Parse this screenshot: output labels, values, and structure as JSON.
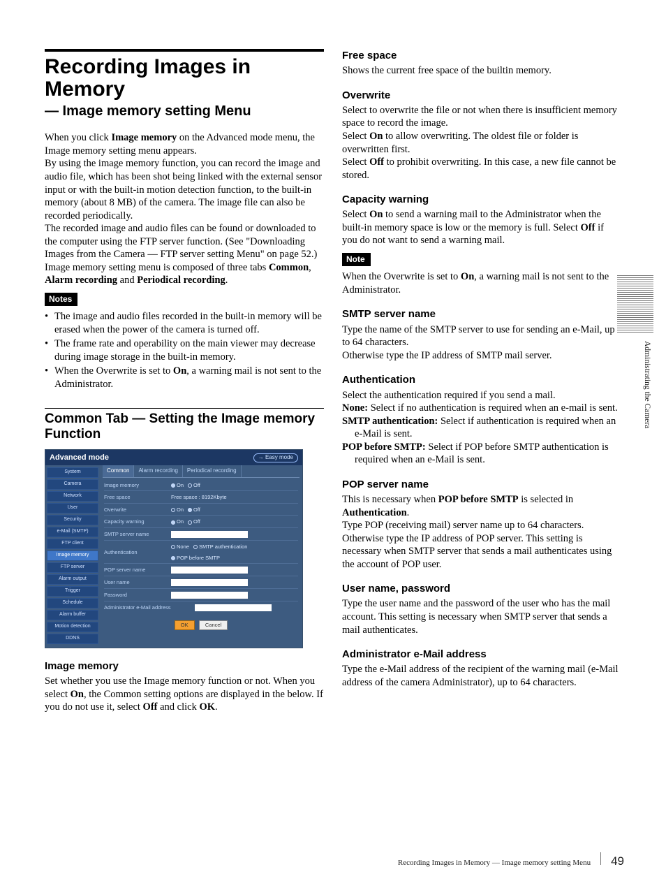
{
  "title": "Recording Images in Memory",
  "subtitle": "— Image memory setting Menu",
  "intro": {
    "p1a": "When you click ",
    "p1b": "Image memory",
    "p1c": " on the Advanced mode menu, the Image memory setting menu appears.",
    "p2": "By using the image memory function, you can record the image and audio file, which has been shot being linked with the external sensor input or with the built-in motion detection function, to the built-in memory (about 8 MB) of the camera. The image file can also be recorded periodically.",
    "p3": "The recorded image and audio files can be found or downloaded to the computer using the FTP server function. (See \"Downloading Images from the Camera — FTP server setting Menu\" on page 52.)",
    "p4a": "Image memory setting menu is composed of three tabs ",
    "p4b": "Common",
    "p4c": ", ",
    "p4d": "Alarm recording",
    "p4e": " and ",
    "p4f": "Periodical recording",
    "p4g": "."
  },
  "notes_label": "Notes",
  "notes": [
    "The image and audio files recorded in the built-in memory will be erased when the power of the camera is turned off.",
    "The frame rate and operability on the main viewer may decrease during image storage in the built-in memory."
  ],
  "note3_a": "When the Overwrite is set to ",
  "note3_b": "On",
  "note3_c": ", a warning mail is not sent to the Administrator.",
  "section_common": "Common Tab — Setting the Image memory Function",
  "ui": {
    "title": "Advanced mode",
    "easy": "→ Easy mode",
    "sidebar": [
      "System",
      "Camera",
      "Network",
      "User",
      "Security",
      "e-Mail (SMTP)",
      "FTP client",
      "Image memory",
      "FTP server",
      "Alarm output",
      "Trigger",
      "Schedule",
      "Alarm buffer",
      "Motion detection",
      "DDNS"
    ],
    "tabs": [
      "Common",
      "Alarm recording",
      "Periodical recording"
    ],
    "rows": {
      "image_memory": "Image memory",
      "free_space": "Free space",
      "free_space_val": "Free space : 8192Kbyte",
      "overwrite": "Overwrite",
      "capacity": "Capacity warning",
      "smtp": "SMTP server name",
      "auth": "Authentication",
      "auth_opts": [
        "None",
        "SMTP authentication",
        "POP before SMTP"
      ],
      "pop": "POP server name",
      "user": "User name",
      "pass": "Password",
      "admin": "Administrator e-Mail address",
      "on": "On",
      "off": "Off"
    },
    "ok": "OK",
    "cancel": "Cancel"
  },
  "left_sections": {
    "image_memory": {
      "h": "Image memory",
      "p_a": "Set whether you use the Image memory function or not. When you select ",
      "p_b": "On",
      "p_c": ", the Common setting options are displayed in the below. If you do not use it, select ",
      "p_d": "Off",
      "p_e": " and click ",
      "p_f": "OK",
      "p_g": "."
    }
  },
  "right": {
    "free_space": {
      "h": "Free space",
      "p": "Shows the current free space of the builtin memory."
    },
    "overwrite": {
      "h": "Overwrite",
      "p1": "Select to overwrite the file or not when there is insufficient memory space to record the image.",
      "p2a": "Select ",
      "p2b": "On",
      "p2c": " to allow overwriting.  The oldest file or folder is overwritten first.",
      "p3a": "Select ",
      "p3b": "Off",
      "p3c": " to prohibit overwriting.  In this case, a new file cannot be stored."
    },
    "capacity": {
      "h": "Capacity warning",
      "p1a": "Select ",
      "p1b": "On",
      "p1c": " to send a warning mail to the Administrator when the built-in memory space is low or the memory is full.  Select ",
      "p1d": "Off",
      "p1e": " if you do not want to send a warning mail."
    },
    "note_label": "Note",
    "note_pa": "When the Overwrite is set to ",
    "note_pb": "On",
    "note_pc": ", a warning mail is not sent to the Administrator.",
    "smtp": {
      "h": "SMTP server name",
      "p1": "Type the name of the SMTP server to use for sending an e-Mail, up to 64 characters.",
      "p2": "Otherwise type the IP address of SMTP mail server."
    },
    "auth": {
      "h": "Authentication",
      "p1": "Select the authentication required if you send a mail.",
      "i1a": "None:",
      "i1b": " Select if no authentication is required when an e-mail is sent.",
      "i2a": "SMTP authentication:",
      "i2b": " Select if authentication is required when an e-Mail is sent.",
      "i3a": "POP before SMTP:",
      "i3b": " Select if POP before SMTP authentication is required when an e-Mail is sent."
    },
    "pop": {
      "h": "POP server name",
      "p1a": "This is necessary when ",
      "p1b": "POP before SMTP",
      "p1c": " is selected in ",
      "p1d": "Authentication",
      "p1e": ".",
      "p2": "Type POP (receiving mail) server name up to 64 characters. Otherwise type the IP address of POP server. This setting is necessary when SMTP server that sends a mail authenticates using the account of POP user."
    },
    "user": {
      "h": "User name, password",
      "p": "Type the user name and the password of the user who has the mail account. This setting is necessary when SMTP server that sends a mail authenticates."
    },
    "admin": {
      "h": "Administrator e-Mail address",
      "p": "Type the e-Mail address of the recipient of the warning mail (e-Mail address of the camera Administrator), up to 64 characters."
    }
  },
  "side_tab": "Administrating the Camera",
  "footer_text": "Recording Images in Memory — Image memory setting Menu",
  "page_number": "49"
}
